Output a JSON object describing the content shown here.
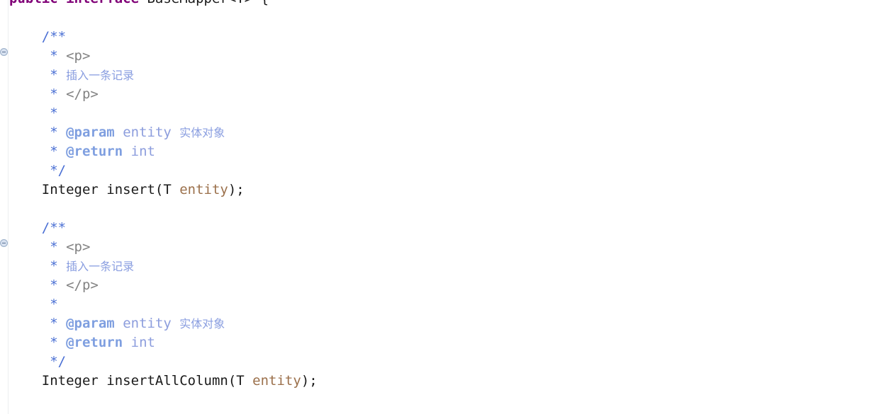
{
  "editor": {
    "language": "Java",
    "background_color": "#ffffff",
    "colors": {
      "keyword": "#800077",
      "plain_text": "#1a1a1a",
      "parameter": "#9b704b",
      "javadoc_asterisk": "#4a6fd4",
      "javadoc_tag": "#7f9fe0",
      "javadoc_value": "#8c9ddd",
      "javadoc_html_tag": "#828282",
      "javadoc_chinese_text": "#8a9ee0",
      "gutter_separator": "#eceff1",
      "fold_icon_fill": "#d6e0ef",
      "fold_icon_border": "#9aafc9"
    },
    "gutter": {
      "fold_markers": [
        {
          "name": "collapse-javadoc-insert",
          "state": "expanded",
          "glyph": "minus-circle-icon"
        },
        {
          "name": "collapse-javadoc-insert-all-column",
          "state": "expanded",
          "glyph": "minus-circle-icon"
        }
      ]
    },
    "code_lines": [
      {
        "tokens": [
          {
            "t": "public",
            "c": "kw"
          },
          {
            "t": " ",
            "c": "plain"
          },
          {
            "t": "interface",
            "c": "kw"
          },
          {
            "t": " BaseMapper<T> {",
            "c": "plain"
          }
        ]
      },
      {
        "tokens": []
      },
      {
        "tokens": [
          {
            "t": "    ",
            "c": "plain"
          },
          {
            "t": "/**",
            "c": "jd-star"
          }
        ]
      },
      {
        "tokens": [
          {
            "t": "     ",
            "c": "plain"
          },
          {
            "t": "* ",
            "c": "jd-star"
          },
          {
            "t": "<p>",
            "c": "jd-html"
          }
        ]
      },
      {
        "tokens": [
          {
            "t": "     ",
            "c": "plain"
          },
          {
            "t": "* ",
            "c": "jd-star"
          },
          {
            "t": "插入一条记录",
            "c": "jd-cn"
          }
        ]
      },
      {
        "tokens": [
          {
            "t": "     ",
            "c": "plain"
          },
          {
            "t": "* ",
            "c": "jd-star"
          },
          {
            "t": "</p>",
            "c": "jd-html"
          }
        ]
      },
      {
        "tokens": [
          {
            "t": "     ",
            "c": "plain"
          },
          {
            "t": "*",
            "c": "jd-star"
          }
        ]
      },
      {
        "tokens": [
          {
            "t": "     ",
            "c": "plain"
          },
          {
            "t": "* ",
            "c": "jd-star"
          },
          {
            "t": "@param",
            "c": "jd-tag"
          },
          {
            "t": " ",
            "c": "plain"
          },
          {
            "t": "entity",
            "c": "jd-val"
          },
          {
            "t": " ",
            "c": "plain"
          },
          {
            "t": "实体对象",
            "c": "jd-cn"
          }
        ]
      },
      {
        "tokens": [
          {
            "t": "     ",
            "c": "plain"
          },
          {
            "t": "* ",
            "c": "jd-star"
          },
          {
            "t": "@return",
            "c": "jd-tag"
          },
          {
            "t": " ",
            "c": "plain"
          },
          {
            "t": "int",
            "c": "jd-val"
          }
        ]
      },
      {
        "tokens": [
          {
            "t": "     ",
            "c": "plain"
          },
          {
            "t": "*/",
            "c": "jd-star"
          }
        ]
      },
      {
        "tokens": [
          {
            "t": "    Integer insert(T ",
            "c": "plain"
          },
          {
            "t": "entity",
            "c": "param"
          },
          {
            "t": ");",
            "c": "plain"
          }
        ]
      },
      {
        "tokens": []
      },
      {
        "tokens": [
          {
            "t": "    ",
            "c": "plain"
          },
          {
            "t": "/**",
            "c": "jd-star"
          }
        ]
      },
      {
        "tokens": [
          {
            "t": "     ",
            "c": "plain"
          },
          {
            "t": "* ",
            "c": "jd-star"
          },
          {
            "t": "<p>",
            "c": "jd-html"
          }
        ]
      },
      {
        "tokens": [
          {
            "t": "     ",
            "c": "plain"
          },
          {
            "t": "* ",
            "c": "jd-star"
          },
          {
            "t": "插入一条记录",
            "c": "jd-cn"
          }
        ]
      },
      {
        "tokens": [
          {
            "t": "     ",
            "c": "plain"
          },
          {
            "t": "* ",
            "c": "jd-star"
          },
          {
            "t": "</p>",
            "c": "jd-html"
          }
        ]
      },
      {
        "tokens": [
          {
            "t": "     ",
            "c": "plain"
          },
          {
            "t": "*",
            "c": "jd-star"
          }
        ]
      },
      {
        "tokens": [
          {
            "t": "     ",
            "c": "plain"
          },
          {
            "t": "* ",
            "c": "jd-star"
          },
          {
            "t": "@param",
            "c": "jd-tag"
          },
          {
            "t": " ",
            "c": "plain"
          },
          {
            "t": "entity",
            "c": "jd-val"
          },
          {
            "t": " ",
            "c": "plain"
          },
          {
            "t": "实体对象",
            "c": "jd-cn"
          }
        ]
      },
      {
        "tokens": [
          {
            "t": "     ",
            "c": "plain"
          },
          {
            "t": "* ",
            "c": "jd-star"
          },
          {
            "t": "@return",
            "c": "jd-tag"
          },
          {
            "t": " ",
            "c": "plain"
          },
          {
            "t": "int",
            "c": "jd-val"
          }
        ]
      },
      {
        "tokens": [
          {
            "t": "     ",
            "c": "plain"
          },
          {
            "t": "*/",
            "c": "jd-star"
          }
        ]
      },
      {
        "tokens": [
          {
            "t": "    Integer insertAllColumn(T ",
            "c": "plain"
          },
          {
            "t": "entity",
            "c": "param"
          },
          {
            "t": ");",
            "c": "plain"
          }
        ]
      }
    ]
  }
}
